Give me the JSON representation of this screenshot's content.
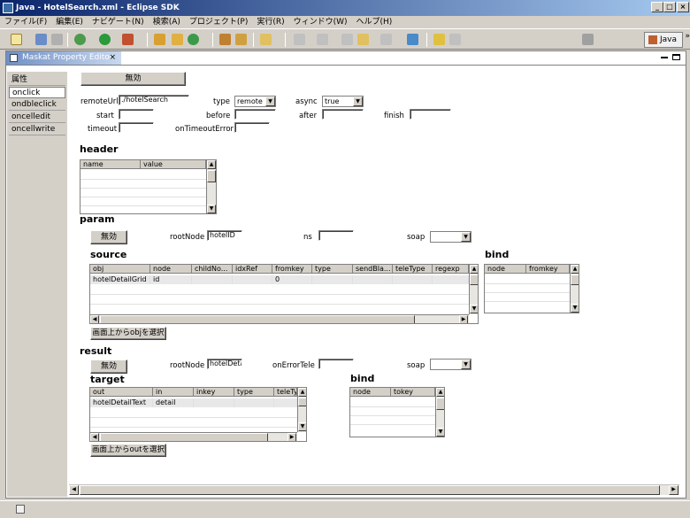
{
  "window": {
    "title": "Java - HotelSearch.xml - Eclipse SDK",
    "min": "_",
    "max": "□",
    "close": "×"
  },
  "menu": [
    "ファイル(F)",
    "編集(E)",
    "ナビゲート(N)",
    "検索(A)",
    "プロジェクト(P)",
    "実行(R)",
    "ウィンドウ(W)",
    "ヘルプ(H)"
  ],
  "perspective": {
    "label": "Java",
    "overflow": "»"
  },
  "editor_tab": {
    "label": "Maskat Property Editor",
    "close": "×"
  },
  "nav": [
    "属性",
    "onclick",
    "ondbleclick",
    "oncelledit",
    "oncellwrite"
  ],
  "top": {
    "disable_button": "無効",
    "remoteUrl_label": "remoteUrl",
    "remoteUrl": "./hotelSearch",
    "type_label": "type",
    "type_value": "remote",
    "async_label": "async",
    "async_value": "true",
    "start_label": "start",
    "before_label": "before",
    "after_label": "after",
    "finish_label": "finish",
    "timeout_label": "timeout",
    "onTimeoutError_label": "onTimeoutError"
  },
  "header_section": {
    "title": "header",
    "cols": [
      "name",
      "value"
    ]
  },
  "param": {
    "title": "param",
    "disable_button": "無効",
    "rootNode_label": "rootNode",
    "rootNode": "hotelID",
    "ns_label": "ns",
    "soap_label": "soap",
    "source_title": "source",
    "source_cols": [
      "obj",
      "node",
      "childNo...",
      "idxRef",
      "fromkey",
      "type",
      "sendBla...",
      "teleType",
      "regexp"
    ],
    "source_rows": [
      [
        "hotelDetailGrid",
        "id",
        "",
        "",
        "0",
        "",
        "",
        "",
        ""
      ]
    ],
    "bind_title": "bind",
    "bind_cols": [
      "node",
      "fromkey"
    ],
    "select_button": "画面上からobjを選択"
  },
  "result": {
    "title": "result",
    "disable_button": "無効",
    "rootNode_label": "rootNode",
    "rootNode": "hotelDeta",
    "onErrorTele_label": "onErrorTele",
    "soap_label": "soap",
    "target_title": "target",
    "target_cols": [
      "out",
      "in",
      "inkey",
      "type",
      "teleTy"
    ],
    "target_rows": [
      [
        "hotelDetailText",
        "detail",
        "",
        "",
        ""
      ]
    ],
    "bind_title": "bind",
    "bind_cols": [
      "node",
      "tokey"
    ],
    "select_button": "画面上からoutを選択"
  }
}
